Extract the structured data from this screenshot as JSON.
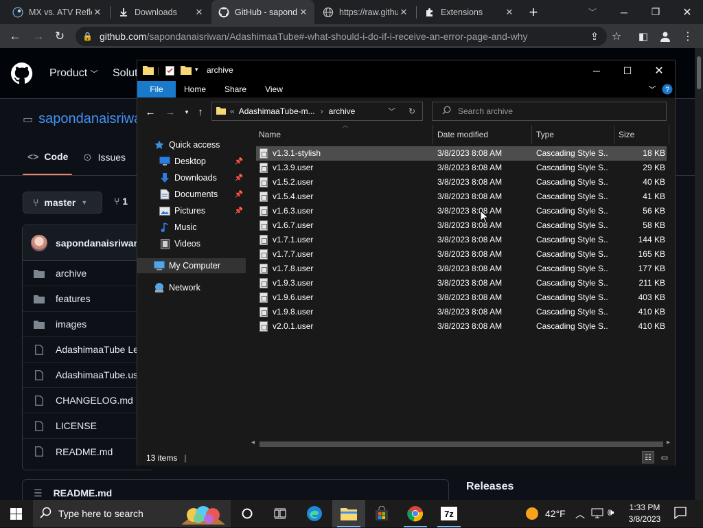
{
  "browser": {
    "tabs": [
      {
        "label": "MX vs. ATV Reflex"
      },
      {
        "label": "Downloads"
      },
      {
        "label": "GitHub - sapond"
      },
      {
        "label": "https://raw.githu"
      },
      {
        "label": "Extensions"
      }
    ],
    "url_host": "github.com",
    "url_path": "/sapondanaisriwan/AdashimaaTube#-what-should-i-do-if-i-receive-an-error-page-and-why"
  },
  "github": {
    "nav": {
      "product": "Product",
      "solutions": "Solut"
    },
    "repo_owner": "sapondanaisriwa",
    "tabs": {
      "code": "Code",
      "issues": "Issues"
    },
    "branch": "master",
    "branch_count": "1",
    "commit_author": "sapondanaisriwan",
    "files": [
      {
        "name": "archive",
        "kind": "folder"
      },
      {
        "name": "features",
        "kind": "folder"
      },
      {
        "name": "images",
        "kind": "folder"
      },
      {
        "name": "AdashimaaTube Le",
        "kind": "file"
      },
      {
        "name": "AdashimaaTube.us",
        "kind": "file"
      },
      {
        "name": "CHANGELOG.md",
        "kind": "file"
      },
      {
        "name": "LICENSE",
        "kind": "file"
      },
      {
        "name": "README.md",
        "kind": "file"
      }
    ],
    "readme_label": "README.md",
    "releases_label": "Releases"
  },
  "explorer": {
    "title": "archive",
    "ribbon_tabs": {
      "file": "File",
      "home": "Home",
      "share": "Share",
      "view": "View"
    },
    "breadcrumb": {
      "chevrons": "«",
      "parent": "AdashimaaTube-m...",
      "current": "archive"
    },
    "search_placeholder": "Search archive",
    "nav": {
      "quick_access": "Quick access",
      "desktop": "Desktop",
      "downloads": "Downloads",
      "documents": "Documents",
      "pictures": "Pictures",
      "music": "Music",
      "videos": "Videos",
      "my_computer": "My Computer",
      "network": "Network"
    },
    "columns": {
      "name": "Name",
      "date": "Date modified",
      "type": "Type",
      "size": "Size"
    },
    "files": [
      {
        "name": "v1.3.1-stylish",
        "date": "3/8/2023 8:08 AM",
        "type": "Cascading Style S...",
        "size": "18 KB"
      },
      {
        "name": "v1.3.9.user",
        "date": "3/8/2023 8:08 AM",
        "type": "Cascading Style S...",
        "size": "29 KB"
      },
      {
        "name": "v1.5.2.user",
        "date": "3/8/2023 8:08 AM",
        "type": "Cascading Style S...",
        "size": "40 KB"
      },
      {
        "name": "v1.5.4.user",
        "date": "3/8/2023 8:08 AM",
        "type": "Cascading Style S...",
        "size": "41 KB"
      },
      {
        "name": "v1.6.3.user",
        "date": "3/8/2023 8:08 AM",
        "type": "Cascading Style S...",
        "size": "56 KB"
      },
      {
        "name": "v1.6.7.user",
        "date": "3/8/2023 8:08 AM",
        "type": "Cascading Style S...",
        "size": "58 KB"
      },
      {
        "name": "v1.7.1.user",
        "date": "3/8/2023 8:08 AM",
        "type": "Cascading Style S...",
        "size": "144 KB"
      },
      {
        "name": "v1.7.7.user",
        "date": "3/8/2023 8:08 AM",
        "type": "Cascading Style S...",
        "size": "165 KB"
      },
      {
        "name": "v1.7.8.user",
        "date": "3/8/2023 8:08 AM",
        "type": "Cascading Style S...",
        "size": "177 KB"
      },
      {
        "name": "v1.9.3.user",
        "date": "3/8/2023 8:08 AM",
        "type": "Cascading Style S...",
        "size": "211 KB"
      },
      {
        "name": "v1.9.6.user",
        "date": "3/8/2023 8:08 AM",
        "type": "Cascading Style S...",
        "size": "403 KB"
      },
      {
        "name": "v1.9.8.user",
        "date": "3/8/2023 8:08 AM",
        "type": "Cascading Style S...",
        "size": "410 KB"
      },
      {
        "name": "v2.0.1.user",
        "date": "3/8/2023 8:08 AM",
        "type": "Cascading Style S...",
        "size": "410 KB"
      }
    ],
    "item_count": "13 items"
  },
  "taskbar": {
    "search_placeholder": "Type here to search",
    "weather": "42°F",
    "time": "1:33 PM",
    "date": "3/8/2023"
  }
}
